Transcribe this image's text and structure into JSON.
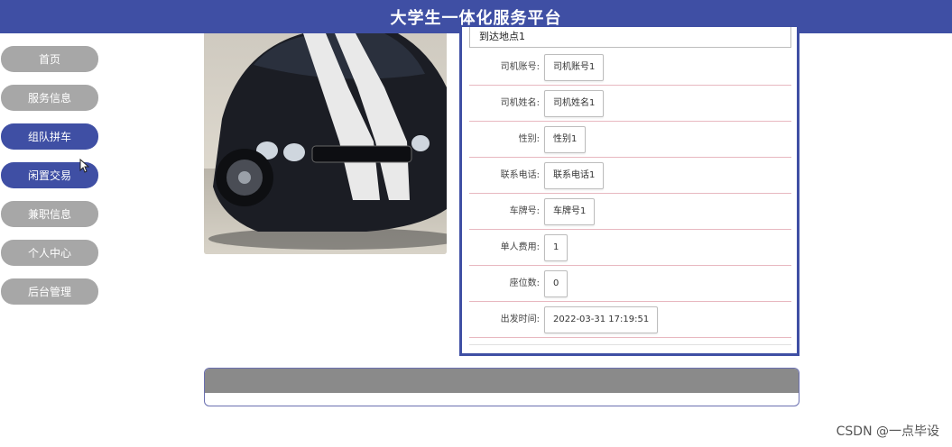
{
  "header": {
    "title": "大学生一体化服务平台"
  },
  "sidebar": {
    "items": [
      {
        "label": "首页",
        "active": false
      },
      {
        "label": "服务信息",
        "active": false
      },
      {
        "label": "组队拼车",
        "active": true
      },
      {
        "label": "闲置交易",
        "active": true
      },
      {
        "label": "兼职信息",
        "active": false
      },
      {
        "label": "个人中心",
        "active": false
      },
      {
        "label": "后台管理",
        "active": false
      }
    ]
  },
  "details": {
    "destination": "到达地点1",
    "fields": [
      {
        "label": "司机账号:",
        "value": "司机账号1"
      },
      {
        "label": "司机姓名:",
        "value": "司机姓名1"
      },
      {
        "label": "性别:",
        "value": "性别1"
      },
      {
        "label": "联系电话:",
        "value": "联系电话1"
      },
      {
        "label": "车牌号:",
        "value": "车牌号1"
      },
      {
        "label": "单人费用:",
        "value": "1"
      },
      {
        "label": "座位数:",
        "value": "0"
      },
      {
        "label": "出发时间:",
        "value": "2022-03-31 17:19:51"
      }
    ]
  },
  "image": {
    "caption": "car-photo"
  },
  "watermark": {
    "text": "CSDN @一点毕设"
  },
  "colors": {
    "primary": "#3f4fa4",
    "nav_inactive": "#a7a7a7",
    "row_divider": "#e8b8c0"
  }
}
